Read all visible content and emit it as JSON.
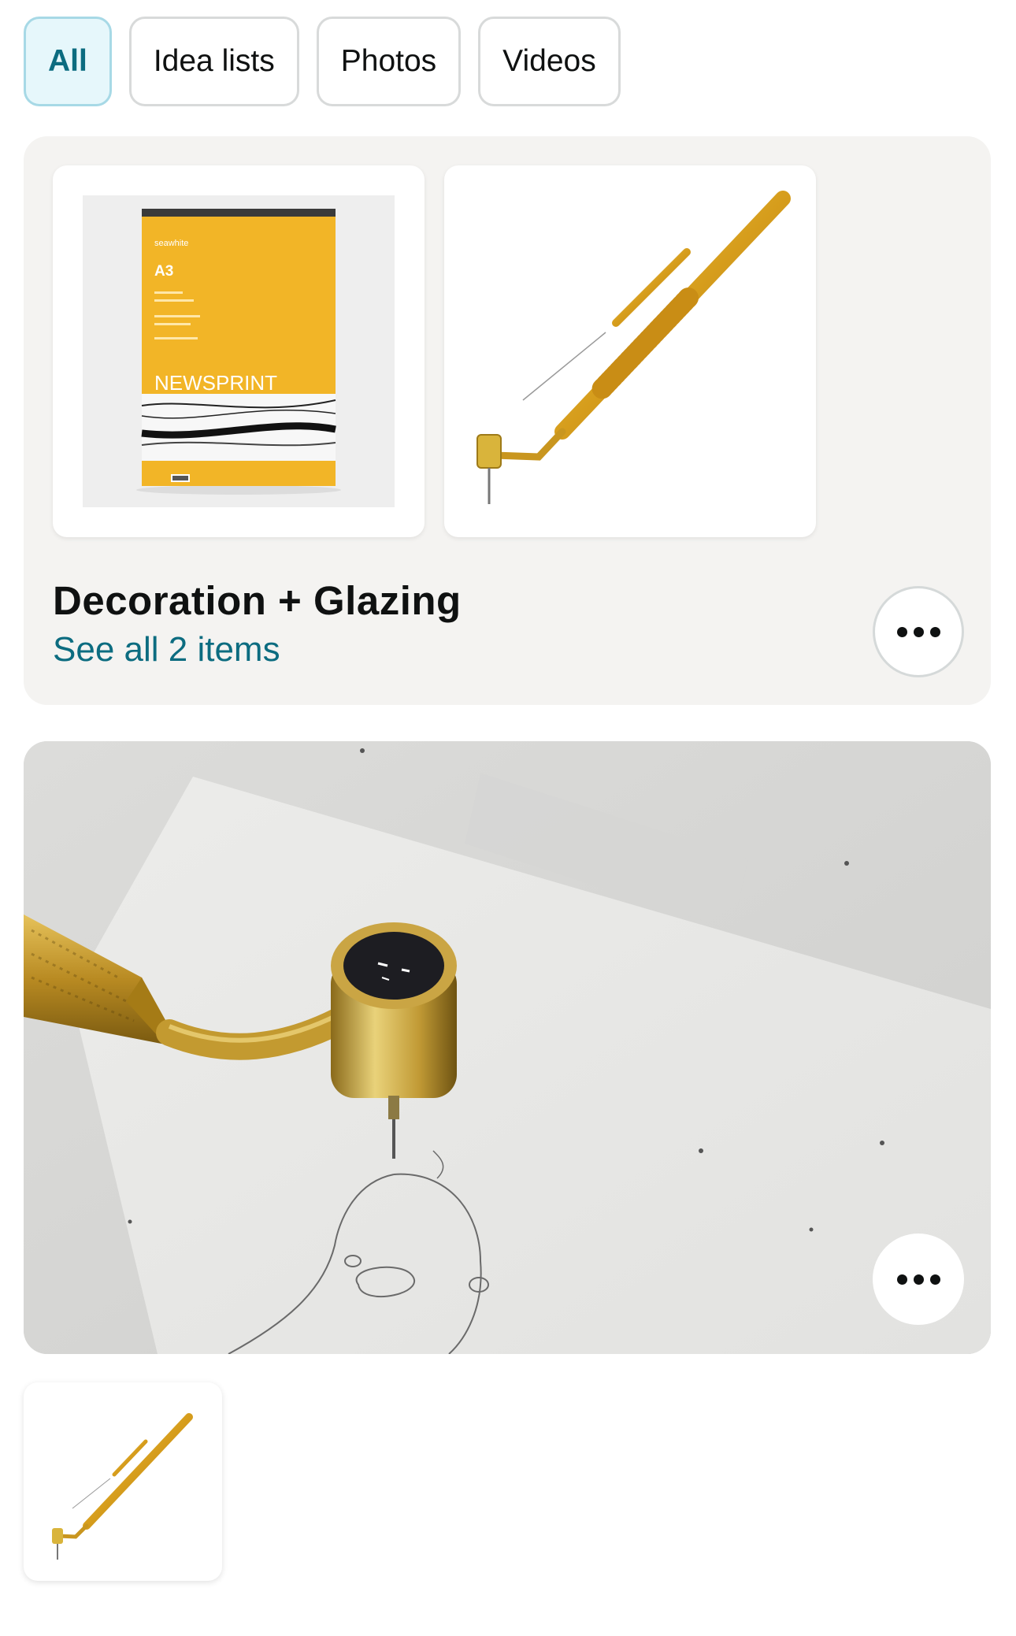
{
  "filters": {
    "all": "All",
    "idea_lists": "Idea lists",
    "photos": "Photos",
    "videos": "Videos",
    "selected": "All"
  },
  "idea_list": {
    "title": "Decoration + Glazing",
    "see_all": "See all 2 items",
    "items": [
      {
        "icon": "newsprint-pad-image",
        "brand": "seawhite",
        "size": "A3",
        "label": "NEWSPRINT"
      },
      {
        "icon": "gold-slip-trailer-pen-image"
      }
    ]
  },
  "video": {
    "icon": "slip-pen-drawing-video"
  },
  "colors": {
    "accent": "#0c6c80",
    "chip_active_bg": "#e6f7fb",
    "card_bg": "#f4f3f1",
    "pad_yellow": "#f2b527",
    "gold": "#d4a32a"
  }
}
